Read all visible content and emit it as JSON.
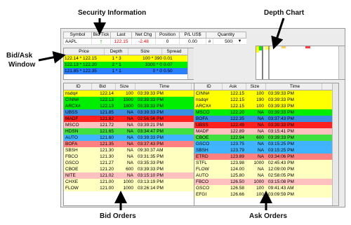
{
  "annotations": {
    "security": "Security Information",
    "depth_chart": "Depth Chart",
    "bidask_line1": "Bid/Ask",
    "bidask_line2": "Window",
    "bid_orders": "Bid Orders",
    "ask_orders": "Ask Orders"
  },
  "security": {
    "headers": [
      "Symbol",
      "Bid Tick",
      "Last",
      "Net Chg",
      "Position",
      "P/L US$",
      "Quantity"
    ],
    "symbol": "AAPL",
    "tick_arrow": "↑",
    "last": "122.15",
    "net_chg": "-2.48",
    "position": "0",
    "pl": "0.00",
    "qty_hash": "#",
    "quantity": "500"
  },
  "depth_window": {
    "headers": [
      "Price",
      "Depth",
      "Size",
      "Spread"
    ],
    "rows": [
      {
        "price": "122.14 * 122.15",
        "depth": "1 * 3",
        "size": "100 * 390",
        "spread": "0.01",
        "color": "#ffff00"
      },
      {
        "price": "122.13 * 122.20",
        "depth": "2 * 1",
        "size": "3300 * 0",
        "spread": "0.07",
        "color": "#00ee00"
      },
      {
        "price": "121.85 * 122.35",
        "depth": "1 * 1",
        "size": "0 * 0",
        "spread": "0.50",
        "color": "#2a7fff"
      }
    ]
  },
  "bid_orders": {
    "headers": [
      "ID",
      "Bid",
      "Size",
      "Time"
    ],
    "rows": [
      {
        "id": "nsdq#",
        "px": "122.14",
        "sz": "100",
        "tm": "03:39:33 PM",
        "color": "#ffff00"
      },
      {
        "id": "CINN#",
        "px": "122.13",
        "sz": "1500",
        "tm": "03:39:33 PM",
        "color": "#00ee00"
      },
      {
        "id": "ARCX#",
        "px": "122.13",
        "sz": "1800",
        "tm": "03:39:33 PM",
        "color": "#00ee00"
      },
      {
        "id": "UBSS",
        "px": "121.85",
        "sz": "NA",
        "tm": "03:39:33 PM",
        "color": "#3b8fe0"
      },
      {
        "id": "MADF",
        "px": "121.82",
        "sz": "NA",
        "tm": "02:56:56 PM",
        "color": "#ff2020"
      },
      {
        "id": "MSCO",
        "px": "121.72",
        "sz": "NA",
        "tm": "03:39:21 PM",
        "color": "#ffc0c0"
      },
      {
        "id": "HDSN",
        "px": "121.65",
        "sz": "NA",
        "tm": "03:34:47 PM",
        "color": "#40e040"
      },
      {
        "id": "AUTO",
        "px": "121.60",
        "sz": "NA",
        "tm": "03:39:33 PM",
        "color": "#40b4ff"
      },
      {
        "id": "BOFA",
        "px": "121.35",
        "sz": "NA",
        "tm": "03:37:43 PM",
        "color": "#ff8080"
      },
      {
        "id": "SBSH",
        "px": "121.30",
        "sz": "NA",
        "tm": "09:30:37 AM",
        "color": "#ffffc0"
      },
      {
        "id": "FBCO",
        "px": "121.30",
        "sz": "NA",
        "tm": "03:31:35 PM",
        "color": "#ffffc0"
      },
      {
        "id": "GSCO",
        "px": "121.27",
        "sz": "NA",
        "tm": "03:35:33 PM",
        "color": "#ffffc0"
      },
      {
        "id": "CBOE",
        "px": "121.20",
        "sz": "600",
        "tm": "03:39:33 PM",
        "color": "#ffffc0"
      },
      {
        "id": "NITE",
        "px": "121.02",
        "sz": "NA",
        "tm": "03:15:10 PM",
        "color": "#ffc0c0"
      },
      {
        "id": "CHXE",
        "px": "121.00",
        "sz": "1000",
        "tm": "03:13:19 PM",
        "color": "#ffffc0"
      },
      {
        "id": "FLOW",
        "px": "121.00",
        "sz": "1000",
        "tm": "03:26:14 PM",
        "color": "#ffffc0"
      }
    ]
  },
  "ask_orders": {
    "headers": [
      "ID",
      "Ask",
      "Size",
      "Time"
    ],
    "rows": [
      {
        "id": "CINN#",
        "px": "122.15",
        "sz": "100",
        "tm": "03:39:33 PM",
        "color": "#ffff00"
      },
      {
        "id": "nsdq#",
        "px": "122.15",
        "sz": "190",
        "tm": "03:39:33 PM",
        "color": "#ffff00"
      },
      {
        "id": "ARCX#",
        "px": "122.15",
        "sz": "100",
        "tm": "03:39:33 PM",
        "color": "#ffff00"
      },
      {
        "id": "MSCO",
        "px": "122.20",
        "sz": "NA",
        "tm": "03:39:33 PM",
        "color": "#00ee00"
      },
      {
        "id": "BOFA",
        "px": "122.35",
        "sz": "NA",
        "tm": "03:37:43 PM",
        "color": "#3b8fe0"
      },
      {
        "id": "UBSS",
        "px": "122.49",
        "sz": "NA",
        "tm": "03:39:33 PM",
        "color": "#ff2020"
      },
      {
        "id": "MADF",
        "px": "122.89",
        "sz": "NA",
        "tm": "03:15:41 PM",
        "color": "#ffc0c0"
      },
      {
        "id": "CBOE",
        "px": "122.94",
        "sz": "600",
        "tm": "03:39:33 PM",
        "color": "#40e040"
      },
      {
        "id": "GSCO",
        "px": "123.75",
        "sz": "NA",
        "tm": "03:15:25 PM",
        "color": "#40b4ff"
      },
      {
        "id": "SBSH",
        "px": "123.79",
        "sz": "NA",
        "tm": "03:15:25 PM",
        "color": "#40b4ff"
      },
      {
        "id": "ETRD",
        "px": "123.89",
        "sz": "NA",
        "tm": "03:34:06 PM",
        "color": "#ff8080"
      },
      {
        "id": "STFL",
        "px": "123.98",
        "sz": "1000",
        "tm": "02:45:43 PM",
        "color": "#ffffc0"
      },
      {
        "id": "FLOW",
        "px": "124.00",
        "sz": "NA",
        "tm": "12:09:00 PM",
        "color": "#ffffc0"
      },
      {
        "id": "AUTO",
        "px": "125.80",
        "sz": "NA",
        "tm": "02:58:05 PM",
        "color": "#ffffc0"
      },
      {
        "id": "FBCO",
        "px": "126.50",
        "sz": "1000",
        "tm": "03:15:08 PM",
        "color": "#ffc0c0"
      },
      {
        "id": "GSCO",
        "px": "126.58",
        "sz": "100",
        "tm": "09:41:43 AM",
        "color": "#ffffc0"
      },
      {
        "id": "EFGI",
        "px": "126.66",
        "sz": "100",
        "tm": "03:09:59 PM",
        "color": "#ffffc0"
      }
    ]
  }
}
